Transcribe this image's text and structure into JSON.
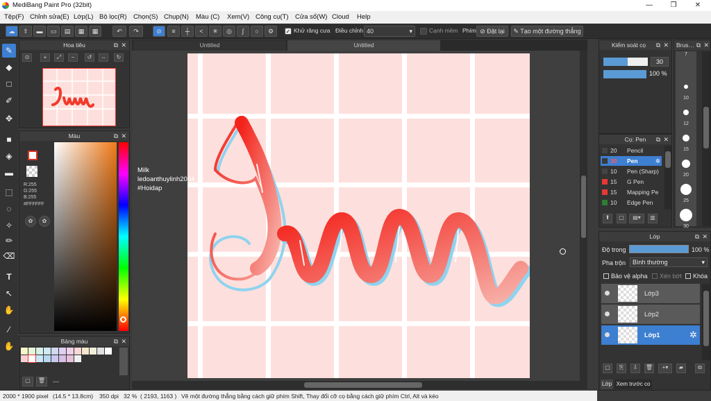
{
  "window": {
    "title": "MediBang Paint Pro (32bit)",
    "minimize": "—",
    "maximize": "❐",
    "close": "✕"
  },
  "menu": [
    "Tệp(F)",
    "Chỉnh sửa(E)",
    "Lớp(L)",
    "Bộ lọc(R)",
    "Chọn(S)",
    "Chụp(N)",
    "Màu (C)",
    "Xem(V)",
    "Công cụ(T)",
    "Cửa sổ(W)",
    "Cloud",
    "Help"
  ],
  "toolbar": {
    "antialias_label": "Khử răng cưa",
    "adjust_label": "Điều chỉnh",
    "adjust_value": "40",
    "edge_label": "Cạnh mềm",
    "key_label": "Phím",
    "reset_label": "Đặt lại",
    "straight_line_label": "Tạo một đường thẳng"
  },
  "tabs": [
    "Untitled",
    "Untitled"
  ],
  "navigator": {
    "title": "Hoa tiêu"
  },
  "color_panel": {
    "title": "Màu",
    "r": "R:255",
    "g": "G:255",
    "b": "B:255",
    "hex": "#FFFFFF"
  },
  "palette": {
    "title": "Bảng màu",
    "more": "---",
    "swatches": [
      "#f5f5c8",
      "#e8f5d8",
      "#d8f0e8",
      "#d0e8f0",
      "#d0d8f0",
      "#e0d0f0",
      "#f0d0e8",
      "#f8d8d8",
      "#f8e8d0",
      "#f0f0d8",
      "#e0e0e0",
      "#ffffff",
      "#f8d0d0",
      "#ffffff",
      "#c8e8f8",
      "#b8d8f0",
      "#c8c8f0",
      "#d8c0e8",
      "#e8c0d8",
      "#f0f0f0"
    ]
  },
  "overlay_text": [
    "Milk",
    "ledoanthuylinh2004",
    "#Hoidap"
  ],
  "brush_control": {
    "title": "Kiểm soát cọ",
    "size": "30",
    "opacity": "100 %"
  },
  "brush_list": {
    "title": "Cọ: Pen",
    "items": [
      {
        "size": "20",
        "name": "Pencil",
        "color": "#444444"
      },
      {
        "size": "30",
        "name": "Pen",
        "color": "#3a3a3a"
      },
      {
        "size": "10",
        "name": "Pen (Sharp)",
        "color": "#444444"
      },
      {
        "size": "15",
        "name": "G Pen",
        "color": "#e53935"
      },
      {
        "size": "15",
        "name": "Mapping Pe",
        "color": "#e53935"
      },
      {
        "size": "10",
        "name": "Edge Pen",
        "color": "#2e7d32"
      }
    ]
  },
  "brush_sizes": {
    "title": "Brus…",
    "labels": [
      "7",
      "10",
      "12",
      "15",
      "20",
      "25",
      "30"
    ]
  },
  "layers": {
    "title": "Lớp",
    "opacity_label": "Độ trong",
    "opacity_value": "100 %",
    "blend_label": "Pha trộn",
    "blend_value": "Bình thường",
    "protect_alpha": "Bảo vệ alpha",
    "clip": "Xén bớt",
    "lock": "Khóa",
    "items": [
      "Lớp3",
      "Lớp2",
      "Lớp1"
    ]
  },
  "bottom_tabs": [
    "Lớp",
    "Xem trước co"
  ],
  "status": {
    "size": "2000 * 1900 pixel",
    "cm": "(14.5 * 13.8cm)",
    "dpi": "350 dpi",
    "zoom": "32 %",
    "coords": "( 2193, 1163 )",
    "hint": "Vẽ một đường thẳng bằng cách giữ phím Shift, Thay đổi cỡ cọ bằng cách giữ phím Ctrl, Alt và kéo"
  },
  "colors": {
    "accent": "#5b9bd5",
    "selected": "#3d7fd1",
    "canvas_bg": "#fde0dd",
    "stroke": "#f23a2a",
    "shadow": "#8fd3ef"
  }
}
